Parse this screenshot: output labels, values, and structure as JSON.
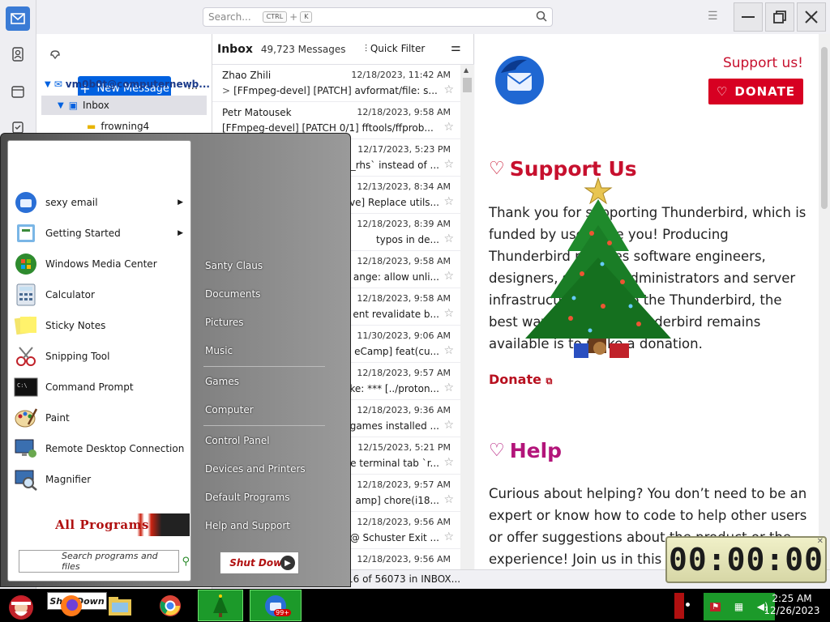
{
  "app": {
    "search_placeholder": "Search...",
    "search_kbd_ctrl": "CTRL",
    "search_kbd_plus": "+",
    "search_kbd_k": "K"
  },
  "folder_pane": {
    "new_message_label": "New Message",
    "more_label": "...",
    "account": "vm0b0t@computernewb...",
    "inbox_label": "Inbox",
    "subfolder": "frowning4"
  },
  "message_list": {
    "folder_title": "Inbox",
    "message_count": "49,723 Messages",
    "quick_filter_label": "Quick Filter",
    "rows": [
      {
        "sender": "Zhao Zhili",
        "date": "12/18/2023, 11:42 AM",
        "subject": "[FFmpeg-devel] [PATCH] avformat/file: s..."
      },
      {
        "sender": "Petr Matousek",
        "date": "12/18/2023, 9:58 AM",
        "subject": "[FFmpeg-devel] [PATCH 0/1] fftools/ffprob..."
      },
      {
        "sender": "",
        "date": "12/17/2023, 5:23 PM",
        "subject": "_rhs` instead of ..."
      },
      {
        "sender": "",
        "date": "12/13/2023, 8:34 AM",
        "subject": "ve] Replace utils..."
      },
      {
        "sender": "",
        "date": "12/18/2023, 8:39 AM",
        "subject": "typos in de..."
      },
      {
        "sender": "",
        "date": "12/18/2023, 9:58 AM",
        "subject": "ange: allow unli..."
      },
      {
        "sender": "",
        "date": "12/18/2023, 9:58 AM",
        "subject": "ent revalidate b..."
      },
      {
        "sender": "",
        "date": "11/30/2023, 9:06 AM",
        "subject": "eCamp] feat(cu..."
      },
      {
        "sender": "",
        "date": "12/18/2023, 9:57 AM",
        "subject": "ke: *** [../proton..."
      },
      {
        "sender": "",
        "date": "12/18/2023, 9:36 AM",
        "subject": "games installed ..."
      },
      {
        "sender": "",
        "date": "12/15/2023, 5:21 PM",
        "subject": "e terminal tab `r..."
      },
      {
        "sender": "",
        "date": "12/18/2023, 9:57 AM",
        "subject": "amp] chore(i18..."
      },
      {
        "sender": "",
        "date": "12/18/2023, 9:56 AM",
        "subject": "@ Schuster Exit ..."
      },
      {
        "sender": "",
        "date": "12/18/2023, 9:56 AM",
        "subject": ""
      }
    ]
  },
  "reading_pane": {
    "support_link": "Support us!",
    "donate_button": "DONATE",
    "support_heading": "Support Us",
    "support_text": "Thank you for supporting Thunderbird, which is funded by users like you! Producing Thunderbird requires software engineers, designers, systems administrators and server infrastructure. To keep the Thunderbird, the best way to ensure Thunderbird remains available is to make a donation.",
    "donate_link": "Donate",
    "help_heading": "Help",
    "help_text": "Curious about helping? You don’t need to be an expert or know how to code to help other users or offer suggestions about the product or the experience! Join us in this c"
  },
  "status_bar": {
    "text": "16 of 56073 in INBOX..."
  },
  "timer": {
    "display": "00:00:00"
  },
  "start_menu": {
    "programs": [
      {
        "label": "sexy email",
        "icon": "thunderbird-icon",
        "has_arrow": true
      },
      {
        "label": "Getting Started",
        "icon": "getting-started-icon",
        "has_arrow": true
      },
      {
        "label": "Windows Media Center",
        "icon": "media-center-icon",
        "has_arrow": false
      },
      {
        "label": "Calculator",
        "icon": "calculator-icon",
        "has_arrow": false
      },
      {
        "label": "Sticky Notes",
        "icon": "sticky-notes-icon",
        "has_arrow": false
      },
      {
        "label": "Snipping Tool",
        "icon": "snipping-tool-icon",
        "has_arrow": false
      },
      {
        "label": "Command Prompt",
        "icon": "command-prompt-icon",
        "has_arrow": false
      },
      {
        "label": "Paint",
        "icon": "paint-icon",
        "has_arrow": false
      },
      {
        "label": "Remote Desktop Connection",
        "icon": "remote-desktop-icon",
        "has_arrow": false
      },
      {
        "label": "Magnifier",
        "icon": "magnifier-icon",
        "has_arrow": false
      }
    ],
    "all_programs": "All Programs",
    "search_placeholder": "Search programs and files",
    "places": [
      "Santy Claus",
      "Documents",
      "Pictures",
      "Music",
      "Games",
      "Computer",
      "Control Panel",
      "Devices and Printers",
      "Default Programs",
      "Help and Support"
    ],
    "shutdown_label": "Shut Down"
  },
  "taskbar": {
    "ghost_shutdown": "Shut Down",
    "clock_time": "2:25 AM",
    "clock_date": "12/26/2023",
    "badge": "99+"
  }
}
